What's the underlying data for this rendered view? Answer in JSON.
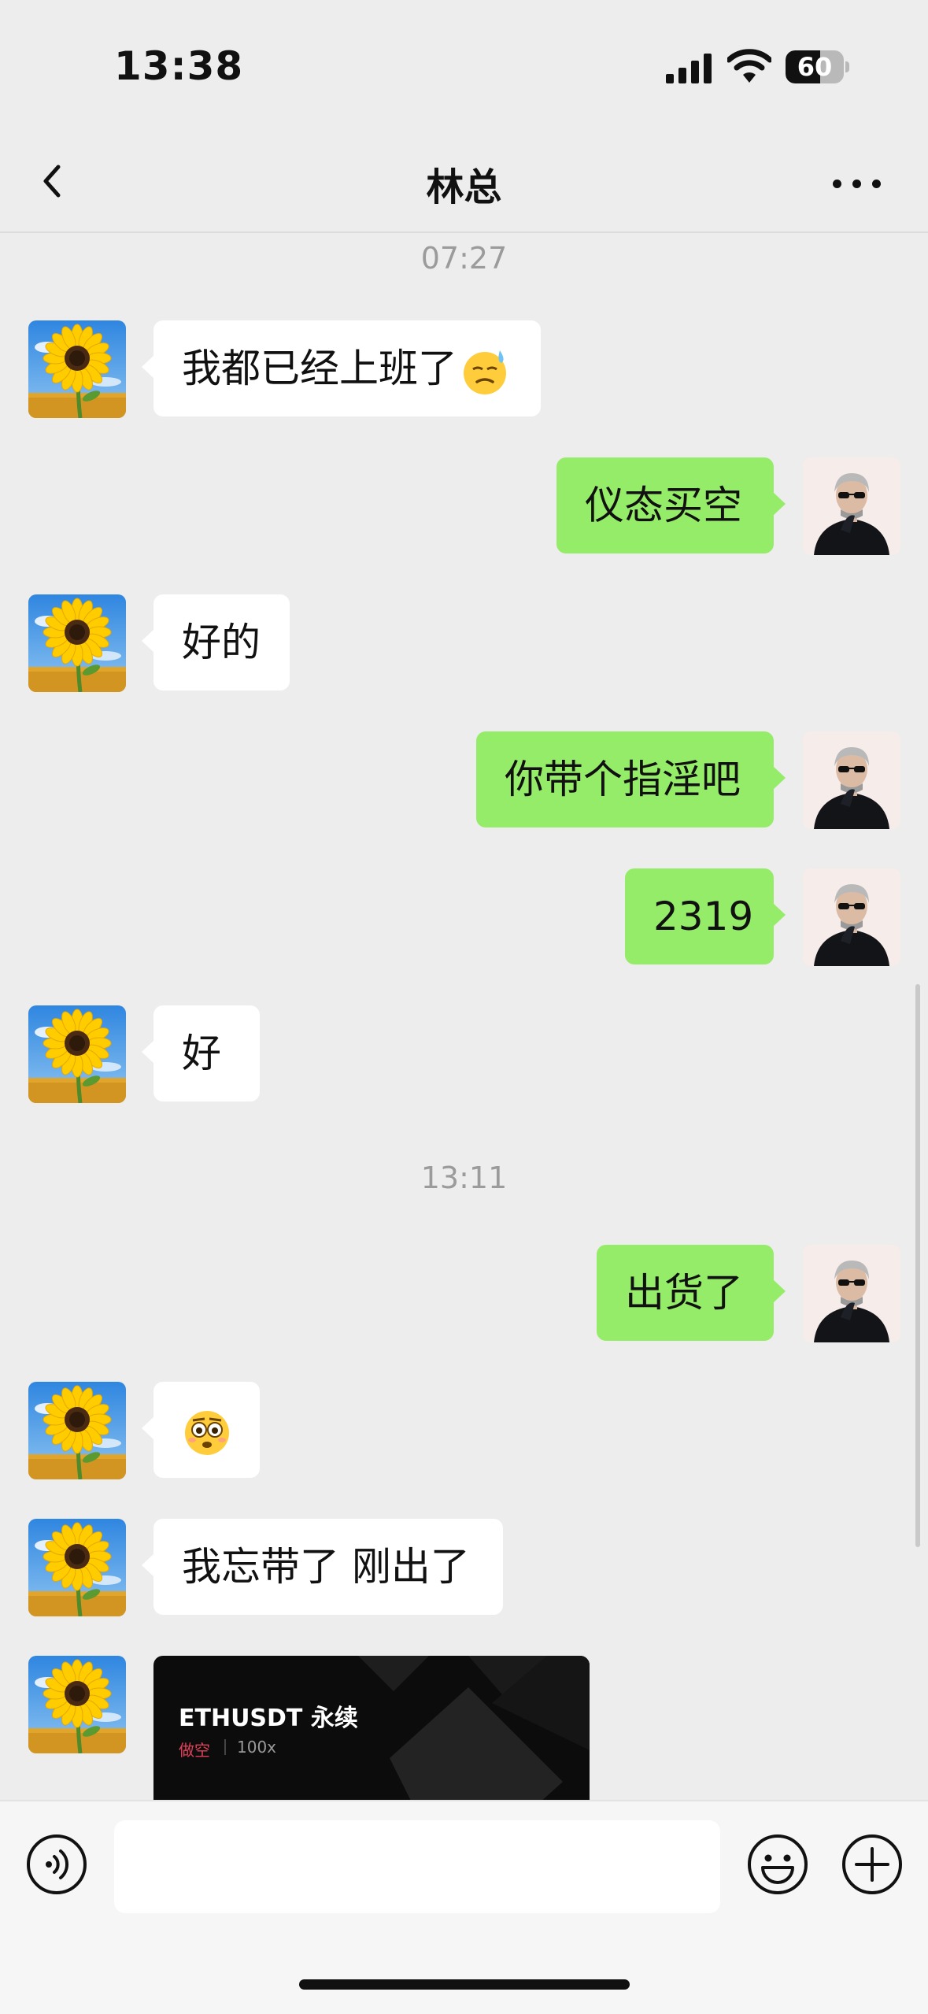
{
  "status": {
    "time": "13:38",
    "battery": "60",
    "battery_level": 0.6
  },
  "header": {
    "title": "林总"
  },
  "messages": [
    {
      "type": "time",
      "text": "07:27"
    },
    {
      "type": "text",
      "side": "left",
      "text": "我都已经上班了",
      "emoji": "sweat-smile-emoji"
    },
    {
      "type": "text",
      "side": "right",
      "text": "仪态买空"
    },
    {
      "type": "text",
      "side": "left",
      "text": "好的"
    },
    {
      "type": "text",
      "side": "right",
      "text": "你带个指淫吧"
    },
    {
      "type": "text",
      "side": "right",
      "text": "2319"
    },
    {
      "type": "text",
      "side": "left",
      "text": "好"
    },
    {
      "type": "time",
      "text": "13:11"
    },
    {
      "type": "text",
      "side": "right",
      "text": "出货了"
    },
    {
      "type": "emoji",
      "side": "left",
      "emoji": "flushed-face-emoji"
    },
    {
      "type": "text",
      "side": "left",
      "text": "我忘带了 刚出了"
    },
    {
      "type": "card",
      "side": "left",
      "title": "ETHUSDT 永续",
      "direction": "做空",
      "leverage": "100x"
    }
  ],
  "input": {
    "placeholder": ""
  },
  "icons": {
    "back": "chevron-left-icon",
    "more": "more-dots-icon",
    "voice": "voice-icon",
    "emoji": "smiley-icon",
    "plus": "plus-icon"
  },
  "colors": {
    "background": "#ededed",
    "incoming_bubble": "#ffffff",
    "outgoing_bubble": "#95ec69",
    "timestamp": "#9b9b9b",
    "card_background": "#0c0c0c",
    "card_short": "#e0405a",
    "card_pnl": "#21c28e"
  }
}
